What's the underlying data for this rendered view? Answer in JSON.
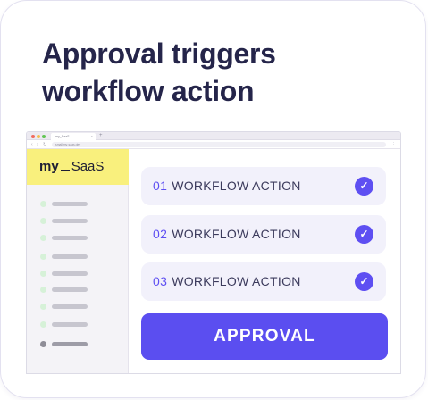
{
  "headline": {
    "line1": "Approval triggers",
    "line2": "workflow action"
  },
  "browser": {
    "tab_title": "my_SaaS",
    "tab_close": "×",
    "new_tab": "+",
    "url": "small.my-saas.dev"
  },
  "sidebar": {
    "logo_left": "my",
    "logo_right": "SaaS",
    "items_count": 9
  },
  "workflow": {
    "steps": [
      {
        "number": "01",
        "label": "WORKFLOW ACTION",
        "status": "completed"
      },
      {
        "number": "02",
        "label": "WORKFLOW ACTION",
        "status": "completed"
      },
      {
        "number": "03",
        "label": "WORKFLOW ACTION",
        "status": "completed"
      }
    ],
    "check_icon": "✓",
    "button_label": "APPROVAL"
  },
  "colors": {
    "accent": "#5b4ef0",
    "heading": "#25254a",
    "logo_bg": "#f9f07d",
    "step_bg": "#f2f1fb"
  }
}
